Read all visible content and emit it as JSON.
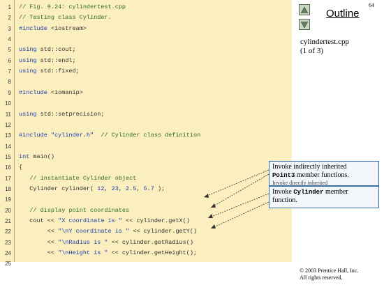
{
  "slide_number": "64",
  "outline": {
    "title": "Outline",
    "file": "cylindertest.cpp",
    "page": "(1 of 3)"
  },
  "code_lines": [
    {
      "n": "1",
      "parts": [
        {
          "t": "// Fig. 9.24: cylindertest.cpp",
          "c": "cm"
        }
      ]
    },
    {
      "n": "2",
      "parts": [
        {
          "t": "// Testing class Cylinder.",
          "c": "cm"
        }
      ]
    },
    {
      "n": "3",
      "parts": [
        {
          "t": "#include",
          "c": "kw"
        },
        {
          "t": " <iostream>",
          "c": ""
        }
      ]
    },
    {
      "n": "4",
      "parts": []
    },
    {
      "n": "5",
      "parts": [
        {
          "t": "using",
          "c": "kw"
        },
        {
          "t": " std::cout;",
          "c": ""
        }
      ]
    },
    {
      "n": "6",
      "parts": [
        {
          "t": "using",
          "c": "kw"
        },
        {
          "t": " std::endl;",
          "c": ""
        }
      ]
    },
    {
      "n": "7",
      "parts": [
        {
          "t": "using",
          "c": "kw"
        },
        {
          "t": " std::fixed;",
          "c": ""
        }
      ]
    },
    {
      "n": "8",
      "parts": []
    },
    {
      "n": "9",
      "parts": [
        {
          "t": "#include",
          "c": "kw"
        },
        {
          "t": " <iomanip>",
          "c": ""
        }
      ]
    },
    {
      "n": "10",
      "parts": []
    },
    {
      "n": "11",
      "parts": [
        {
          "t": "using",
          "c": "kw"
        },
        {
          "t": " std::setprecision;",
          "c": ""
        }
      ]
    },
    {
      "n": "12",
      "parts": []
    },
    {
      "n": "13",
      "parts": [
        {
          "t": "#include",
          "c": "kw"
        },
        {
          "t": " ",
          "c": ""
        },
        {
          "t": "\"cylinder.h\"",
          "c": "st"
        },
        {
          "t": "  ",
          "c": ""
        },
        {
          "t": "// Cylinder class definition",
          "c": "cm"
        }
      ]
    },
    {
      "n": "14",
      "parts": []
    },
    {
      "n": "15",
      "parts": [
        {
          "t": "int",
          "c": "kw"
        },
        {
          "t": " main()",
          "c": ""
        }
      ]
    },
    {
      "n": "16",
      "parts": [
        {
          "t": "{",
          "c": ""
        }
      ]
    },
    {
      "n": "17",
      "parts": [
        {
          "t": "   ",
          "c": ""
        },
        {
          "t": "// instantiate Cylinder object",
          "c": "cm"
        }
      ]
    },
    {
      "n": "18",
      "parts": [
        {
          "t": "   Cylinder cylinder( ",
          "c": ""
        },
        {
          "t": "12",
          "c": "nm"
        },
        {
          "t": ", ",
          "c": ""
        },
        {
          "t": "23",
          "c": "nm"
        },
        {
          "t": ", ",
          "c": ""
        },
        {
          "t": "2.5",
          "c": "nm"
        },
        {
          "t": ", ",
          "c": ""
        },
        {
          "t": "5.7",
          "c": "nm"
        },
        {
          "t": " );",
          "c": ""
        }
      ]
    },
    {
      "n": "19",
      "parts": []
    },
    {
      "n": "20",
      "parts": [
        {
          "t": "   ",
          "c": ""
        },
        {
          "t": "// display point coordinates",
          "c": "cm"
        }
      ]
    },
    {
      "n": "21",
      "parts": [
        {
          "t": "   cout << ",
          "c": ""
        },
        {
          "t": "\"X coordinate is \"",
          "c": "st"
        },
        {
          "t": " << cylinder.getX()",
          "c": ""
        }
      ]
    },
    {
      "n": "22",
      "parts": [
        {
          "t": "        << ",
          "c": ""
        },
        {
          "t": "\"\\nY coordinate is \"",
          "c": "st"
        },
        {
          "t": " << cylinder.getY()",
          "c": ""
        }
      ]
    },
    {
      "n": "23",
      "parts": [
        {
          "t": "        << ",
          "c": ""
        },
        {
          "t": "\"\\nRadius is \"",
          "c": "st"
        },
        {
          "t": " << cylinder.getRadius()",
          "c": ""
        }
      ]
    },
    {
      "n": "24",
      "parts": [
        {
          "t": "        << ",
          "c": ""
        },
        {
          "t": "\"\\nHeight is \"",
          "c": "st"
        },
        {
          "t": " << cylinder.getHeight();",
          "c": ""
        }
      ]
    },
    {
      "n": "25",
      "parts": []
    }
  ],
  "callouts": {
    "first": {
      "line1": "Invoke indirectly inherited",
      "code": "Point3",
      "line2_rest": " member functions.",
      "overlap": "Invoke directly inherited"
    },
    "second": {
      "pre": "Invoke ",
      "code": "Cylinder",
      "post": " member",
      "line2": "function."
    }
  },
  "copyright": {
    "line1": "© 2003 Prentice Hall, Inc.",
    "line2": "All rights reserved."
  },
  "colors": {
    "code_background": "#fbefbf",
    "comment": "#2e6b2e",
    "keyword": "#1b3cb0",
    "callout_border": "#3a6fa8"
  },
  "icons": [
    "up-arrow-icon",
    "down-arrow-icon"
  ]
}
